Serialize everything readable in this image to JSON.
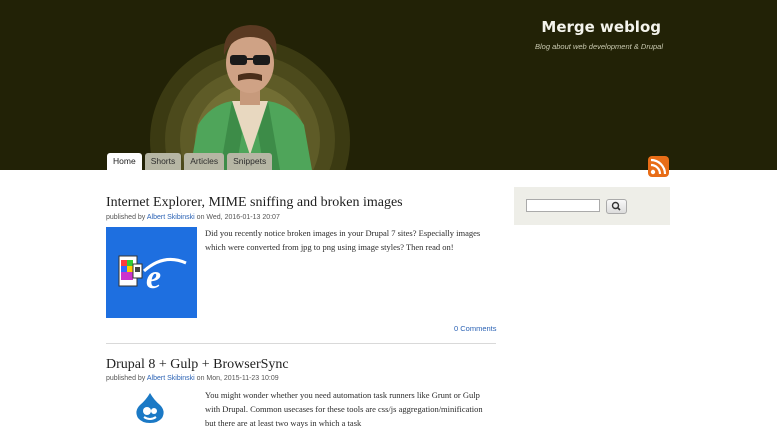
{
  "site": {
    "name": "Merge weblog",
    "slogan": "Blog about web development & Drupal"
  },
  "tabs": [
    {
      "label": "Home"
    },
    {
      "label": "Shorts"
    },
    {
      "label": "Articles"
    },
    {
      "label": "Snippets"
    }
  ],
  "posts": [
    {
      "title": "Internet Explorer, MIME sniffing and broken images",
      "published_prefix": "published by ",
      "author": "Albert Skibinski",
      "date_text": " on Wed, 2016-01-13 20:07",
      "teaser": "Did you recently notice broken images in your Drupal 7 sites? Especially images which were converted from jpg to png using image styles? Then read on!",
      "comments": "0 Comments",
      "thumb_icon": "ie-broken-image-icon"
    },
    {
      "title": "Drupal 8 + Gulp + BrowserSync",
      "published_prefix": "published by ",
      "author": "Albert Skibinski",
      "date_text": " on Mon, 2015-11-23 10:09",
      "teaser": "You might wonder whether you need automation task runners like Grunt or Gulp with Drupal. Common usecases for these tools are css/js aggregation/minification but there are at least two ways in which a task",
      "thumb_icon": "drupal-logo-icon"
    }
  ],
  "search": {
    "value": ""
  },
  "colors": {
    "header_bg": "#222206",
    "link": "#2c63b5",
    "rss": "#e86d17",
    "ie_blue": "#1e6fe0"
  }
}
